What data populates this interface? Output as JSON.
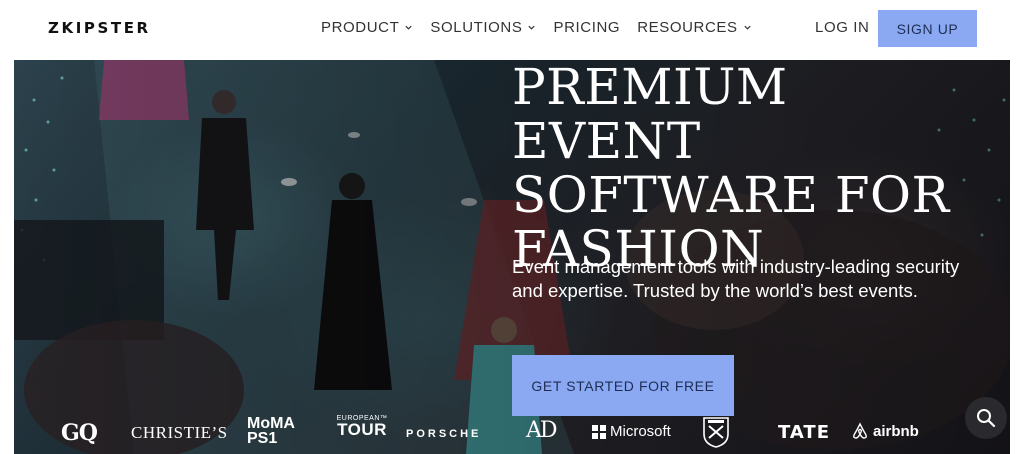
{
  "header": {
    "logo": "ZKIPSTER",
    "nav": [
      {
        "label": "PRODUCT",
        "dropdown": true
      },
      {
        "label": "SOLUTIONS",
        "dropdown": true
      },
      {
        "label": "PRICING",
        "dropdown": false
      },
      {
        "label": "RESOURCES",
        "dropdown": true
      }
    ],
    "login_label": "LOG IN",
    "signup_label": "SIGN UP"
  },
  "hero": {
    "title_lines": [
      "PREMIUM EVENT",
      "SOFTWARE FOR",
      "FASHION"
    ],
    "subtitle": "Event management tools with industry-leading security and expertise. Trusted by the world’s best events.",
    "cta_label": "GET STARTED FOR FREE"
  },
  "logos": {
    "gq": "GQ",
    "christies": "CHRISTIE’S",
    "moma_line1": "MoMA",
    "moma_line2": "PS1",
    "euro_line1": "EUROPEAN™",
    "euro_line2": "TOUR",
    "porsche": "PORSCHE",
    "ad": "AD",
    "microsoft": "Microsoft",
    "tate": "TATE",
    "airbnb": "airbnb"
  },
  "colors": {
    "accent": "#8aa9f2",
    "accent_text": "#1f2d55",
    "nav_text": "#333333"
  },
  "icons": {
    "search": "magnifier-icon",
    "chevron": "chevron-down-icon"
  }
}
